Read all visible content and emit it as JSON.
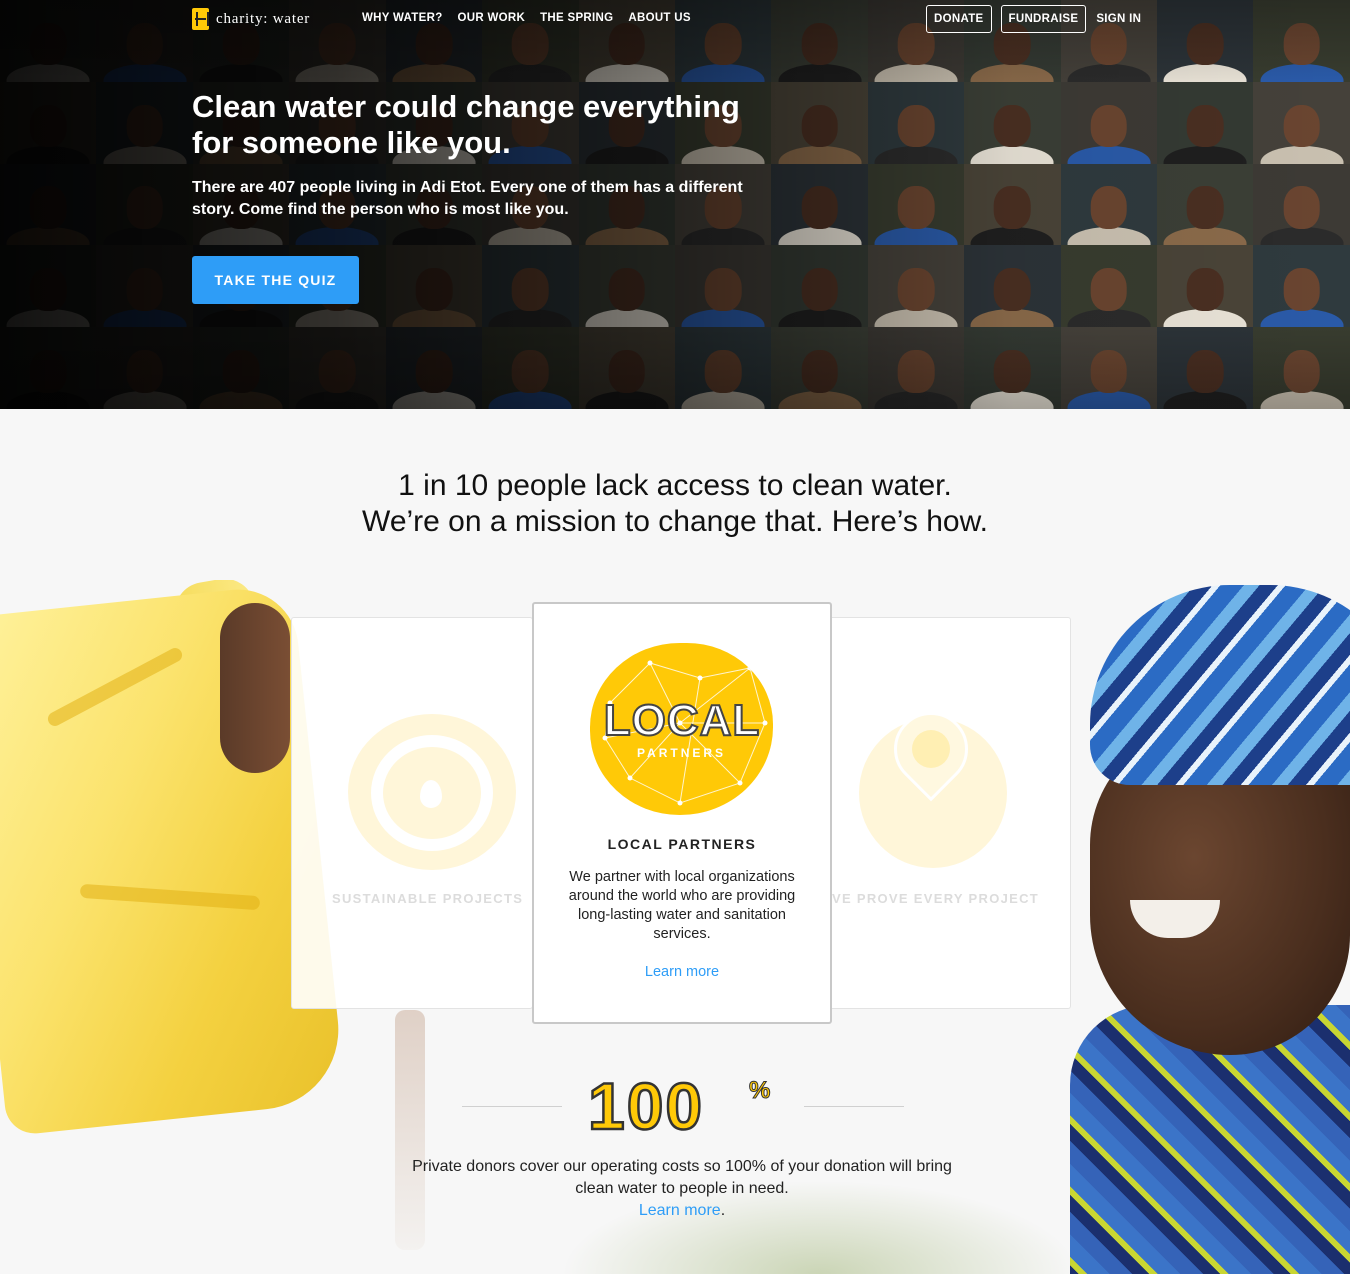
{
  "brand": {
    "logo_text": "charity: water",
    "accent": "#ffc907",
    "link_color": "#2e9df7"
  },
  "nav": {
    "links": [
      "WHY WATER?",
      "OUR WORK",
      "THE SPRING",
      "ABOUT US"
    ],
    "donate": "DONATE",
    "fundraise": "FUNDRAISE",
    "signin": "SIGN IN"
  },
  "hero": {
    "title": "Clean water could change everything for someone like you.",
    "subtitle": "There are 407 people living in Adi Etot. Every one of them has a different story. Come find the person who is most like you.",
    "cta": "TAKE THE QUIZ"
  },
  "mission": {
    "line1": "1 in 10 people lack access to clean water.",
    "line2": "We’re on a mission to change that. Here’s how."
  },
  "cards": {
    "left_label": "SUSTAINABLE PROJECTS",
    "right_label": "VE PROVE EVERY PROJECT",
    "main": {
      "badge_big": "LOCAL",
      "badge_small": "PARTNERS",
      "title": "LOCAL PARTNERS",
      "description": "We partner with local organizations around the world who are providing long-lasting water and sanitation services.",
      "link": "Learn more"
    }
  },
  "donors": {
    "big_number": "100",
    "percent_sign": "%",
    "text": "Private donors cover our operating costs so 100% of your donation will bring clean water to people in need.",
    "link": "Learn more",
    "period": "."
  }
}
